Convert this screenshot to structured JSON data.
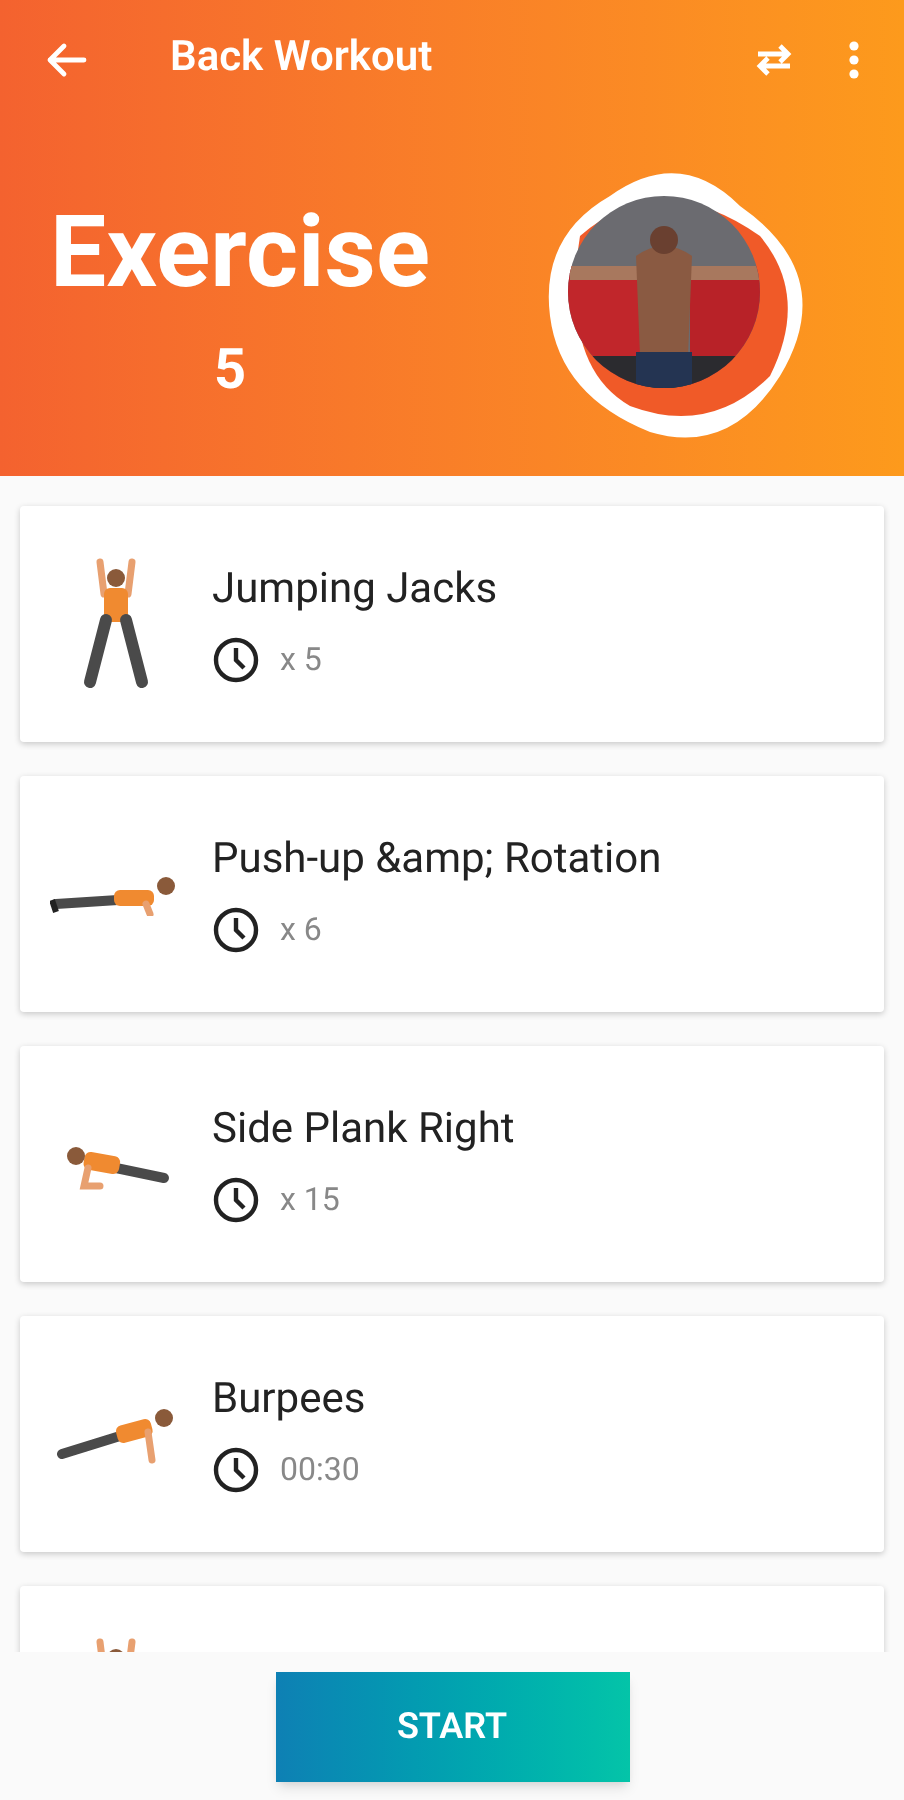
{
  "app_bar": {
    "title": "Back Workout"
  },
  "header": {
    "title": "Exercise",
    "count": "5"
  },
  "exercises": [
    {
      "name": "Jumping Jacks",
      "amount": "x 5",
      "kind": "standing"
    },
    {
      "name": "Push-up &amp; Rotation",
      "amount": "x 6",
      "kind": "pushup"
    },
    {
      "name": "Side Plank Right",
      "amount": "x 15",
      "kind": "sideplank"
    },
    {
      "name": "Burpees",
      "amount": "00:30",
      "kind": "plank"
    },
    {
      "kind": "standing"
    }
  ],
  "start_button": {
    "label": "START"
  }
}
